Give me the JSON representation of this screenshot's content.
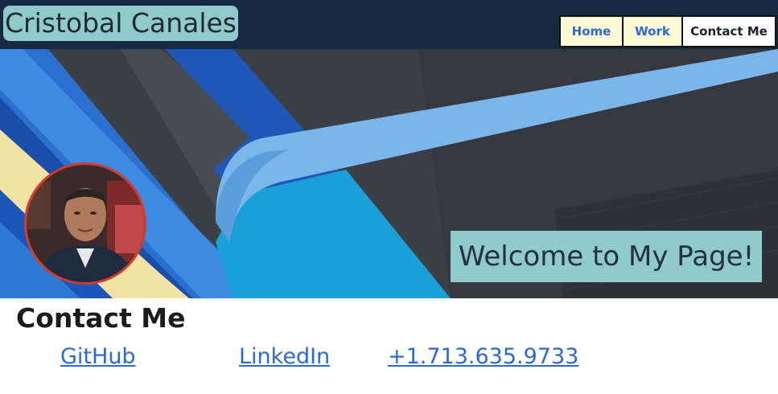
{
  "header": {
    "brand": "Cristobal Canales"
  },
  "nav": {
    "items": [
      {
        "label": "Home"
      },
      {
        "label": "Work"
      },
      {
        "label": "Contact Me"
      }
    ]
  },
  "hero": {
    "welcome": "Welcome to My Page!"
  },
  "contact": {
    "title": "Contact Me",
    "links": [
      {
        "label": "GitHub"
      },
      {
        "label": "LinkedIn"
      },
      {
        "label": "+1.713.635.9733"
      }
    ]
  },
  "colors": {
    "topbar": "#152a42",
    "brand_bg": "#8fcbcb",
    "nav_bg": "#fcf9d3",
    "link": "#2a6ad8",
    "avatar_border": "#d63a2a"
  }
}
